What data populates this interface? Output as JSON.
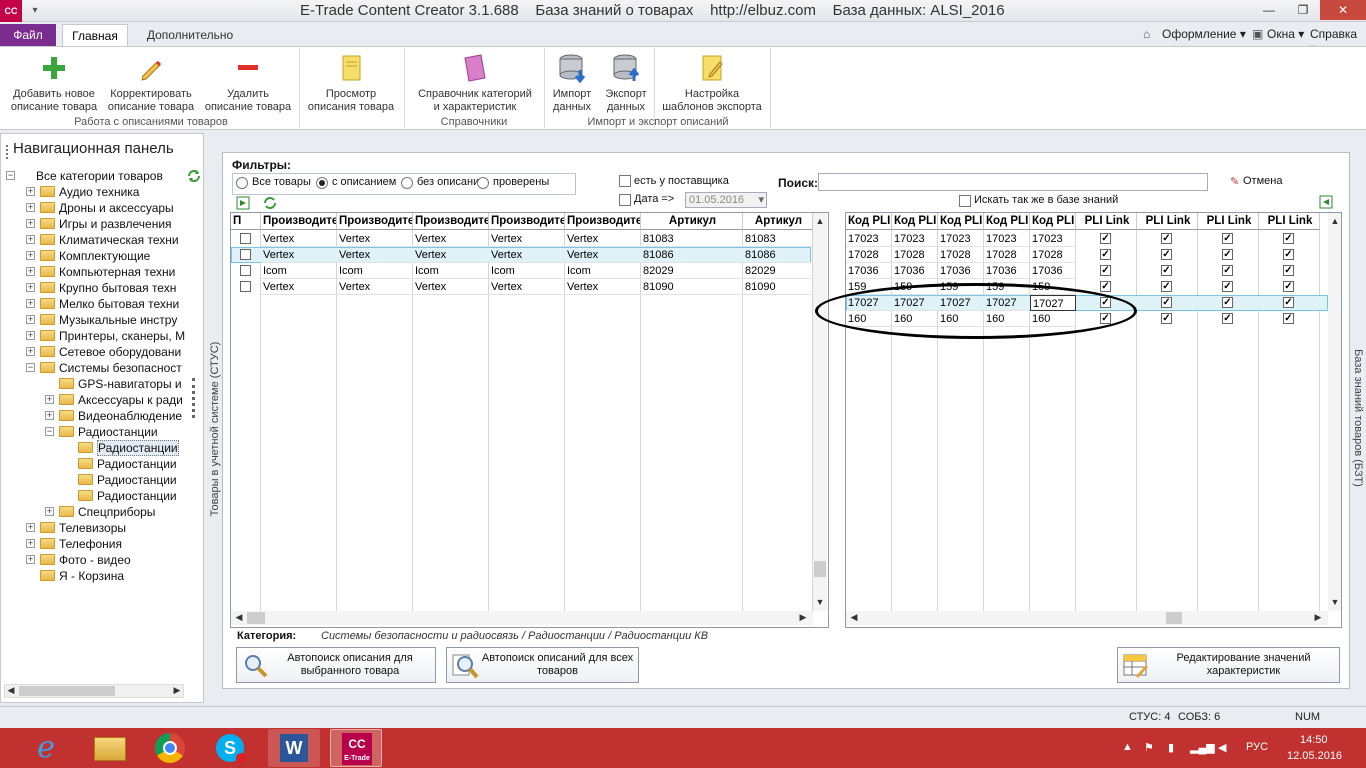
{
  "window": {
    "app_icon": "CC",
    "title": "E-Trade Content Creator 3.1.688    База знаний о товарах    http://elbuz.com    База данных: ALSI_2016",
    "minimize": "—",
    "maximize": "❐",
    "close": "✕"
  },
  "ribbon": {
    "tabs": {
      "file": "Файл",
      "main": "Главная",
      "extra": "Дополнительно"
    },
    "right_menus": {
      "design": "Оформление",
      "windows": "Окна",
      "help": "Справка"
    },
    "buttons": {
      "add": "Добавить новое\nописание товара",
      "edit": "Корректировать\nописание товара",
      "delete": "Удалить\nописание товара",
      "view": "Просмотр\nописания товара",
      "dictionary": "Справочник категорий\nи характеристик",
      "import": "Импорт\nданных",
      "export": "Экспорт\nданных",
      "templates": "Настройка\nшаблонов экспорта"
    },
    "groups": {
      "descriptions": "Работа с описаниями товаров",
      "references": "Справочники",
      "import_export": "Импорт и экспорт описаний"
    }
  },
  "nav": {
    "header": "Навигационная панель",
    "tree": [
      {
        "label": "Все категории товаров",
        "level": 0,
        "exp": "−"
      },
      {
        "label": "Аудио техника",
        "level": 1,
        "exp": "+"
      },
      {
        "label": "Дроны и аксессуары",
        "level": 1,
        "exp": "+"
      },
      {
        "label": "Игры и развлечения",
        "level": 1,
        "exp": "+"
      },
      {
        "label": "Климатическая техни",
        "level": 1,
        "exp": "+"
      },
      {
        "label": "Комплектующие",
        "level": 1,
        "exp": "+"
      },
      {
        "label": "Компьютерная техни",
        "level": 1,
        "exp": "+"
      },
      {
        "label": "Крупно бытовая техн",
        "level": 1,
        "exp": "+"
      },
      {
        "label": "Мелко бытовая техни",
        "level": 1,
        "exp": "+"
      },
      {
        "label": "Музыкальные инстру",
        "level": 1,
        "exp": "+"
      },
      {
        "label": "Принтеры, сканеры, М",
        "level": 1,
        "exp": "+"
      },
      {
        "label": "Сетевое оборудовани",
        "level": 1,
        "exp": "+"
      },
      {
        "label": "Системы безопасност",
        "level": 1,
        "exp": "−"
      },
      {
        "label": "GPS-навигаторы и",
        "level": 2,
        "exp": ""
      },
      {
        "label": "Аксессуары к ради",
        "level": 2,
        "exp": "+"
      },
      {
        "label": "Видеонаблюдение",
        "level": 2,
        "exp": "+"
      },
      {
        "label": "Радиостанции",
        "level": 2,
        "exp": "−"
      },
      {
        "label": "Радиостанции",
        "level": 3,
        "exp": "",
        "selected": true
      },
      {
        "label": "Радиостанции",
        "level": 3,
        "exp": ""
      },
      {
        "label": "Радиостанции",
        "level": 3,
        "exp": ""
      },
      {
        "label": "Радиостанции",
        "level": 3,
        "exp": ""
      },
      {
        "label": "Спецприборы",
        "level": 2,
        "exp": "+"
      },
      {
        "label": "Телевизоры",
        "level": 1,
        "exp": "+"
      },
      {
        "label": "Телефония",
        "level": 1,
        "exp": "+"
      },
      {
        "label": "Фото - видео",
        "level": 1,
        "exp": "+"
      },
      {
        "label": "Я - Корзина",
        "level": 1,
        "exp": ""
      }
    ]
  },
  "side_tabs": {
    "left": "Товары в учетной системе (СТУС)",
    "right": "База знаний товаров (БЗТ)"
  },
  "filters": {
    "label": "Фильтры:",
    "radios": [
      {
        "label": "Все товары",
        "checked": false
      },
      {
        "label": "с описанием",
        "checked": true
      },
      {
        "label": "без описания",
        "checked": false
      },
      {
        "label": "проверены",
        "checked": false
      }
    ],
    "supplier": "есть у поставщика",
    "date_label": "Дата =>",
    "date_value": "01.05.2016",
    "search_label": "Поиск:",
    "search_value": "",
    "cancel": "Отмена",
    "search_kb": "Искать так же в базе знаний"
  },
  "left_grid": {
    "headers": [
      "П",
      "Производите",
      "Производите",
      "Производите",
      "Производите",
      "Производите",
      "Артикул",
      "Артикул"
    ],
    "rows": [
      [
        "",
        "Vertex",
        "Vertex",
        "Vertex",
        "Vertex",
        "Vertex",
        "81083",
        "81083"
      ],
      [
        "",
        "Vertex",
        "Vertex",
        "Vertex",
        "Vertex",
        "Vertex",
        "81086",
        "81086"
      ],
      [
        "",
        "Icom",
        "Icom",
        "Icom",
        "Icom",
        "Icom",
        "82029",
        "82029"
      ],
      [
        "",
        "Vertex",
        "Vertex",
        "Vertex",
        "Vertex",
        "Vertex",
        "81090",
        "81090"
      ]
    ]
  },
  "right_grid": {
    "headers": [
      "Код PLI",
      "Код PLI",
      "Код PLI",
      "Код PLI",
      "Код PLI",
      "PLI Link",
      "PLI Link",
      "PLI Link",
      "PLI Link"
    ],
    "rows": [
      [
        "17023",
        "17023",
        "17023",
        "17023",
        "17023"
      ],
      [
        "17028",
        "17028",
        "17028",
        "17028",
        "17028"
      ],
      [
        "17036",
        "17036",
        "17036",
        "17036",
        "17036"
      ],
      [
        "159",
        "159",
        "159",
        "159",
        "159"
      ],
      [
        "17027",
        "17027",
        "17027",
        "17027",
        "17027"
      ],
      [
        "160",
        "160",
        "160",
        "160",
        "160"
      ]
    ],
    "check": "✓"
  },
  "category": {
    "label": "Категория:",
    "path": "Системы безопасности и радиосвязь / Радиостанции / Радиостанции КВ"
  },
  "actions": {
    "auto_one": "Автопоиск описания для\nвыбранного товара",
    "auto_all": "Автопоиск описаний для всех\nтоваров",
    "edit_values": "Редактирование значений\nхарактеристик"
  },
  "status": {
    "stus": "СТУС: 4",
    "sobz": "СОБЗ: 6",
    "num": "NUM"
  },
  "taskbar": {
    "lang": "РУС",
    "time": "14:50",
    "date": "12.05.2016",
    "cc_label": "E-Trade"
  },
  "colors": {
    "accent": "#7b2c8f",
    "taskbar": "#c1312f",
    "selection": "#dff2f8"
  }
}
